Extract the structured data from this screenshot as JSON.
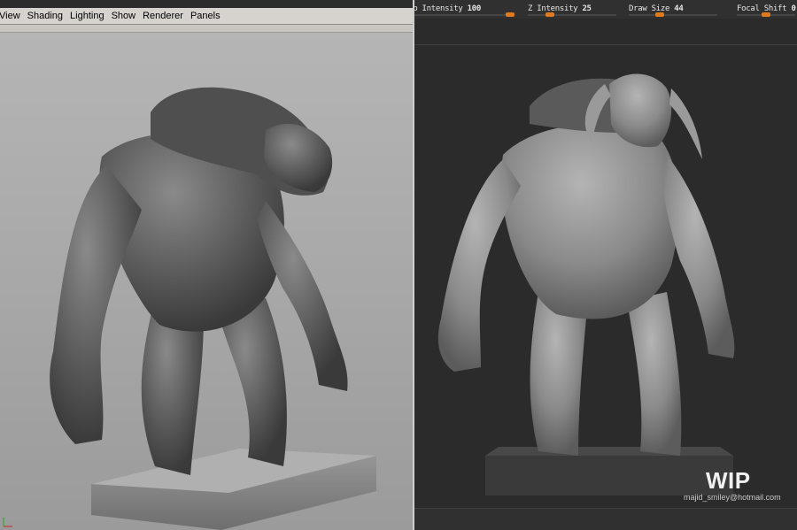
{
  "maya": {
    "menu": [
      "View",
      "Shading",
      "Lighting",
      "Show",
      "Renderer",
      "Panels"
    ],
    "colors": {
      "viewport": "#a3a3a3",
      "menubar": "#d6d3ce",
      "model": "#5a5a5a"
    }
  },
  "zbrush": {
    "sliders": [
      {
        "label": "Rgb Intensity",
        "value": "100",
        "fraction": 1.0
      },
      {
        "label": "Z Intensity",
        "value": "25",
        "fraction": 0.25
      },
      {
        "label": "Draw Size",
        "value": "44",
        "fraction": 0.35
      },
      {
        "label": "Focal Shift",
        "value": "0",
        "fraction": 0.5
      }
    ],
    "watermark": "WIP",
    "email": "majid_smiley@hotmail.com",
    "colors": {
      "background": "#2b2b2b",
      "slider_knob": "#e07a1e",
      "model": "#8a8a8a"
    }
  }
}
